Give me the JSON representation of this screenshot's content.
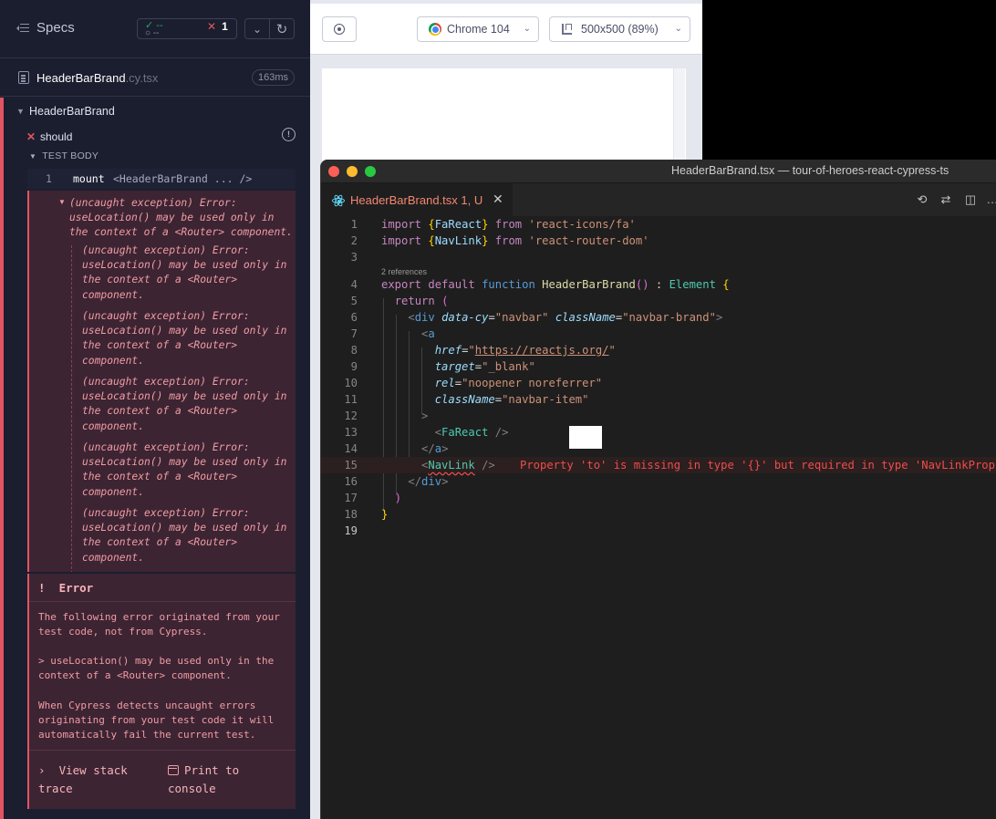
{
  "cypress": {
    "specs_label": "Specs",
    "stats": {
      "passed": "--",
      "pending": "--",
      "failed": "1"
    },
    "spec": {
      "name": "HeaderBarBrand",
      "ext": ".cy.tsx",
      "duration": "163ms"
    },
    "suite_title": "HeaderBarBrand",
    "test_label": "should",
    "body_header": "TEST BODY",
    "command": {
      "number": "1",
      "name": "mount",
      "message": "<HeaderBarBrand ... />"
    },
    "exception_main": "(uncaught exception)  Error: useLocation() may be used only in the context of a <Router> component.",
    "exception_repeat": "(uncaught exception)  Error: useLocation() may be used only in the context of a <Router> component.",
    "error_card": {
      "title": "Error",
      "origin": "The following error originated from your test code, not from Cypress.",
      "message": "> useLocation() may be used only in the context of a <Router> component.",
      "explain": "When Cypress detects uncaught errors originating from your test code it will automatically fail the current test.",
      "stack_btn": "View stack trace",
      "print_btn": "Print to console"
    }
  },
  "aut": {
    "browser": "Chrome 104",
    "viewport": "500x500 (89%)"
  },
  "vscode": {
    "window_title": "HeaderBarBrand.tsx — tour-of-heroes-react-cypress-ts",
    "tab_label": "HeaderBarBrand.tsx 1, U",
    "references": "2 references",
    "line_numbers": [
      "1",
      "2",
      "3",
      "4",
      "5",
      "6",
      "7",
      "8",
      "9",
      "10",
      "11",
      "12",
      "13",
      "14",
      "15",
      "16",
      "17",
      "18",
      "19"
    ],
    "inline_error": "Property 'to' is missing in type '{}' but required in type 'NavLinkProps"
  },
  "colors": {
    "cypress_bg": "#1b1e2e",
    "fail_red": "#e05561",
    "pass_green": "#1fa971",
    "editor_bg": "#1e1e1e",
    "error_text": "#f14c4c"
  }
}
